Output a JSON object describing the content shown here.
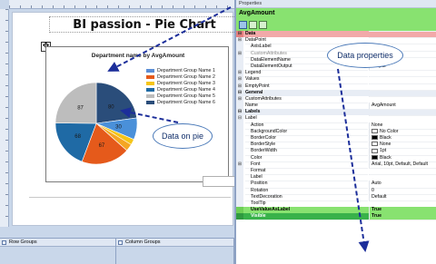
{
  "report": {
    "title": "BI passion - Pie Chart",
    "page_box_text": "[&",
    "chart": {
      "colors": {
        "slate": "#2a4d7a",
        "orange": "#f5a623",
        "gold": "#f5c518",
        "red_orange": "#e55a1b",
        "teal": "#1f6aa5",
        "gray": "#bdbdbd",
        "blue_highlight": "#4a90d9"
      }
    }
  },
  "chart_data": {
    "type": "pie",
    "title": "Department name by AvgAmount",
    "categories": [
      "Department Group Name 1",
      "Department Group Name 2",
      "Department Group Name 3",
      "Department Group Name 4",
      "Department Group Name 5",
      "Department Group Name 6"
    ],
    "legend_colors": [
      "#5b8ed6",
      "#e55a1b",
      "#f5c518",
      "#1f6aa5",
      "#bdbdbd",
      "#2a4d7a"
    ],
    "slices": [
      {
        "label": "80",
        "value": 80,
        "color": "#2a4d7a"
      },
      {
        "label": "30",
        "value": 30,
        "color": "#4a90d9"
      },
      {
        "label": "",
        "value": 8,
        "color": "#f5c518"
      },
      {
        "label": "",
        "value": 10,
        "color": "#f5a623"
      },
      {
        "label": "67",
        "value": 67,
        "color": "#e55a1b"
      },
      {
        "label": "68",
        "value": 68,
        "color": "#1f6aa5"
      },
      {
        "label": "87",
        "value": 87,
        "color": "#bdbdbd"
      }
    ],
    "legend_position": "right"
  },
  "groups": {
    "row_groups": "Row Groups",
    "column_groups": "Column Groups"
  },
  "callouts": {
    "data_on_pie": "Data on pie",
    "data_properties": "Data properties"
  },
  "properties": {
    "header": "Properties",
    "object_name": "AvgAmount",
    "rows": [
      {
        "gut": "⊟",
        "name": "Data",
        "value": "",
        "kind": "data"
      },
      {
        "gut": "⊞",
        "name": "DataPoint",
        "value": "",
        "kind": "lvl1"
      },
      {
        "gut": "",
        "name": "AxisLabel",
        "value": "",
        "kind": "lvl2"
      },
      {
        "gut": "⊞",
        "name": "CustomAttributes",
        "value": "",
        "kind": "grey"
      },
      {
        "gut": "",
        "name": "DataElementName",
        "value": "",
        "kind": "lvl2"
      },
      {
        "gut": "",
        "name": "DataElementOutput",
        "value": "Output",
        "kind": "lvl2"
      },
      {
        "gut": "⊞",
        "name": "Legend",
        "value": "",
        "kind": "lvl1"
      },
      {
        "gut": "⊞",
        "name": "Values",
        "value": "",
        "kind": "lvl1"
      },
      {
        "gut": "⊞",
        "name": "EmptyPoint",
        "value": "",
        "kind": "lvl1"
      },
      {
        "gut": "⊟",
        "name": "General",
        "value": "",
        "kind": "cat"
      },
      {
        "gut": "⊞",
        "name": "CustomAttributes",
        "value": "",
        "kind": "lvl1"
      },
      {
        "gut": "",
        "name": "Name",
        "value": "AvgAmount",
        "kind": "lvl1"
      },
      {
        "gut": "⊟",
        "name": "Labels",
        "value": "",
        "kind": "cat"
      },
      {
        "gut": "⊟",
        "name": "Label",
        "value": "",
        "kind": "lvl1"
      },
      {
        "gut": "",
        "name": "Action",
        "value": "None",
        "kind": "lvl2"
      },
      {
        "gut": "",
        "name": "BackgroundColor",
        "value": "No Color",
        "kind": "lvl2",
        "swatch": "#ffffff"
      },
      {
        "gut": "",
        "name": "BorderColor",
        "value": "Black",
        "kind": "lvl2",
        "swatch": "#000000"
      },
      {
        "gut": "",
        "name": "BorderStyle",
        "value": "None",
        "kind": "lvl2",
        "swatch": "#ffffff"
      },
      {
        "gut": "",
        "name": "BorderWidth",
        "value": "1pt",
        "kind": "lvl2",
        "swatch": "#ffffff"
      },
      {
        "gut": "",
        "name": "Color",
        "value": "Black",
        "kind": "lvl2",
        "swatch": "#000000"
      },
      {
        "gut": "⊞",
        "name": "Font",
        "value": "Arial, 10pt, Default, Default",
        "kind": "lvl2"
      },
      {
        "gut": "",
        "name": "Format",
        "value": "",
        "kind": "lvl2"
      },
      {
        "gut": "",
        "name": "Label",
        "value": "",
        "kind": "lvl2"
      },
      {
        "gut": "",
        "name": "Position",
        "value": "Auto",
        "kind": "lvl2"
      },
      {
        "gut": "",
        "name": "Rotation",
        "value": "0",
        "kind": "lvl2"
      },
      {
        "gut": "",
        "name": "TextDecoration",
        "value": "Default",
        "kind": "lvl2"
      },
      {
        "gut": "",
        "name": "ToolTip",
        "value": "",
        "kind": "lvl2"
      },
      {
        "gut": "",
        "name": "UseValueAsLabel",
        "value": "True",
        "kind": "sel"
      },
      {
        "gut": "",
        "name": "Visible",
        "value": "True",
        "kind": "sel2"
      }
    ]
  },
  "colors": {
    "accent_green": "#88e270",
    "selected_green": "#38b24a",
    "data_red": "#f2a9a9",
    "arrow_blue": "#1c2e9a"
  }
}
